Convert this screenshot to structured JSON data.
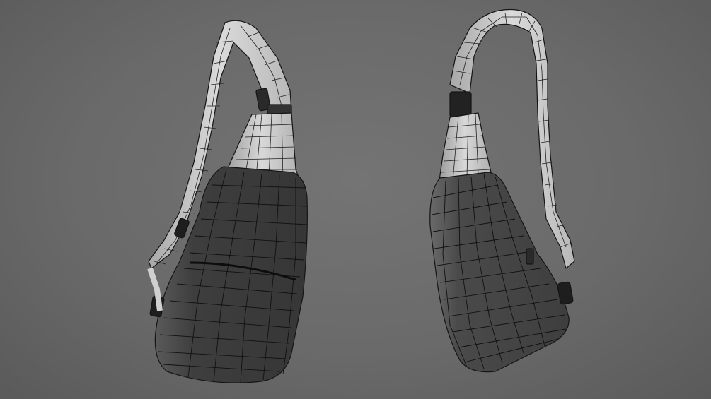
{
  "scene": {
    "description_free": true,
    "background_color": "#6d6d6d",
    "model": {
      "views": [
        {
          "id": "front-view",
          "icon": "sling-bag-wireframe"
        },
        {
          "id": "back-view",
          "icon": "sling-bag-wireframe"
        }
      ],
      "wire_color": "#1a1a1a",
      "body_color_dark": "#3c3c3c",
      "body_color_light": "#cfcfcf",
      "strap_color": "#d4d4d4"
    }
  }
}
